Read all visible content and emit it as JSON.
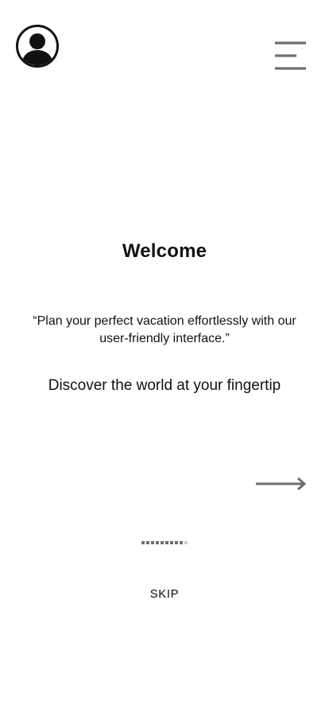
{
  "header": {
    "avatar_icon": "user-avatar-icon",
    "menu_icon": "hamburger-menu-icon"
  },
  "main": {
    "title": "Welcome",
    "quote": "“Plan your perfect vacation effortlessly with our user-friendly interface.”",
    "tagline": "Discover the world at your fingertip"
  },
  "navigation": {
    "next_icon": "right-arrow-icon",
    "progress": 0.85,
    "skip_label": "SKIP"
  },
  "colors": {
    "text": "#111111",
    "icon_gray": "#6f6f6f",
    "progress_track": "#cfcfcf",
    "background": "#ffffff"
  }
}
